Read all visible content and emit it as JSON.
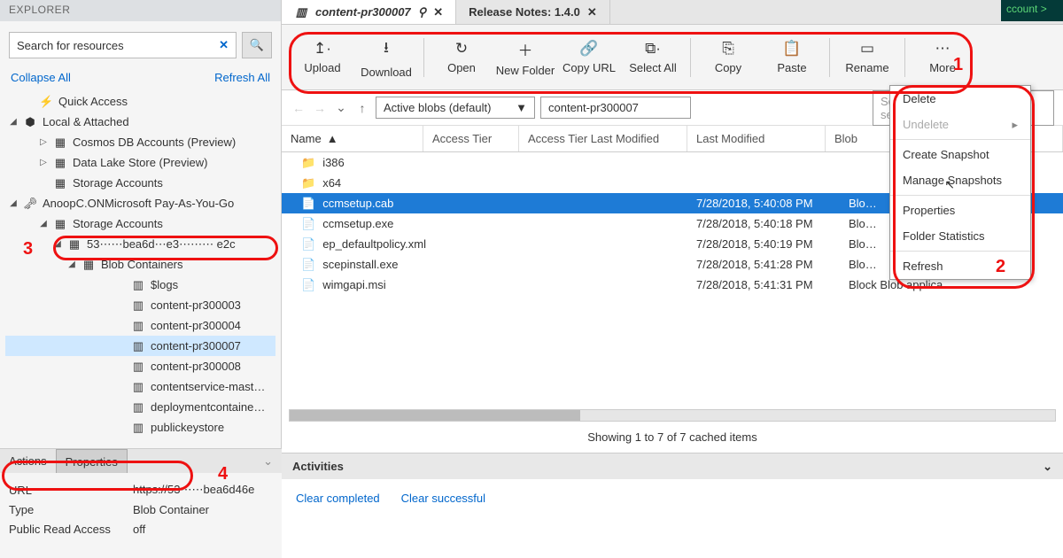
{
  "explorer": {
    "title": "EXPLORER",
    "search_placeholder": "Search for resources",
    "clear": "✕",
    "search_icon": "🔍",
    "collapse": "Collapse All",
    "refresh": "Refresh All"
  },
  "tree": {
    "quick": "Quick Access",
    "local": "Local & Attached",
    "cosmos": "Cosmos DB Accounts (Preview)",
    "datalake": "Data Lake Store (Preview)",
    "storage": "Storage Accounts",
    "sub": "AnoopC.ONMicrosoft Pay-As-You-Go",
    "sub_storage": "Storage Accounts",
    "acct": "53⋯⋯bea6d⋯e3⋯⋯⋯ e2c",
    "blob": "Blob Containers",
    "logs": "$logs",
    "c3": "content-pr300003",
    "c4": "content-pr300004",
    "c7": "content-pr300007",
    "c8": "content-pr300008",
    "svc": "contentservice-mast…",
    "dep": "deploymentcontaine…",
    "pub": "publickeystore"
  },
  "tabs": {
    "t1": "content-pr300007",
    "t2": "Release Notes: 1.4.0"
  },
  "toolbar": {
    "upload": "Upload",
    "download": "Download",
    "open": "Open",
    "newfolder": "New Folder",
    "copyurl": "Copy URL",
    "selectall": "Select All",
    "copy": "Copy",
    "paste": "Paste",
    "rename": "Rename",
    "more": "More"
  },
  "nav": {
    "filter": "Active blobs (default)",
    "path": "content-pr300007",
    "search": "Search by prefix (case-sensitive)"
  },
  "cols": {
    "name": "Name",
    "tier": "Access Tier",
    "tierm": "Access Tier Last Modified",
    "mod": "Last Modified",
    "type": "Blob"
  },
  "rows": [
    {
      "icon": "📁",
      "name": "i386",
      "mod": "",
      "type": ""
    },
    {
      "icon": "📁",
      "name": "x64",
      "mod": "",
      "type": ""
    },
    {
      "icon": "📄",
      "name": "ccmsetup.cab",
      "mod": "7/28/2018, 5:40:08 PM",
      "type": "Blo…",
      "sel": true
    },
    {
      "icon": "📄",
      "name": "ccmsetup.exe",
      "mod": "7/28/2018, 5:40:18 PM",
      "type": "Blo…"
    },
    {
      "icon": "📄",
      "name": "ep_defaultpolicy.xml",
      "mod": "7/28/2018, 5:40:19 PM",
      "type": "Blo…"
    },
    {
      "icon": "📄",
      "name": "scepinstall.exe",
      "mod": "7/28/2018, 5:41:28 PM",
      "type": "Blo…"
    },
    {
      "icon": "📄",
      "name": "wimgapi.msi",
      "mod": "7/28/2018, 5:41:31 PM",
      "type": "Block Blob     applica"
    }
  ],
  "status": "Showing 1 to 7 of 7 cached items",
  "activities": {
    "title": "Activities",
    "clear_comp": "Clear completed",
    "clear_succ": "Clear successful"
  },
  "bottom": {
    "actions": "Actions",
    "properties": "Properties"
  },
  "props": {
    "url_k": "URL",
    "url_v": "https://53⋯⋯bea6d46e",
    "type_k": "Type",
    "type_v": "Blob Container",
    "pra_k": "Public Read Access",
    "pra_v": "off"
  },
  "menu": {
    "delete": "Delete",
    "undelete": "Undelete",
    "snap": "Create Snapshot",
    "msnap": "Manage Snapshots",
    "props": "Properties",
    "fstat": "Folder Statistics",
    "refresh": "Refresh"
  },
  "overlay": "ccount >",
  "anno": {
    "a1": "1",
    "a2": "2",
    "a3": "3",
    "a4": "4"
  }
}
